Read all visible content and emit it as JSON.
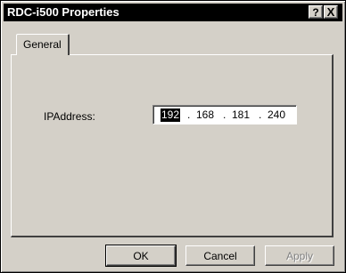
{
  "window": {
    "title": "RDC-i500 Properties",
    "help_glyph": "?",
    "close_glyph": "X"
  },
  "tabs": [
    {
      "label": "General",
      "selected": true
    }
  ],
  "general": {
    "ip_label": "IPAddress:",
    "ip_octets": [
      "192",
      "168",
      "181",
      "240"
    ],
    "ip_separator": ".",
    "selected_octet_index": 0
  },
  "buttons": {
    "ok": "OK",
    "cancel": "Cancel",
    "apply": "Apply",
    "apply_enabled": false
  }
}
